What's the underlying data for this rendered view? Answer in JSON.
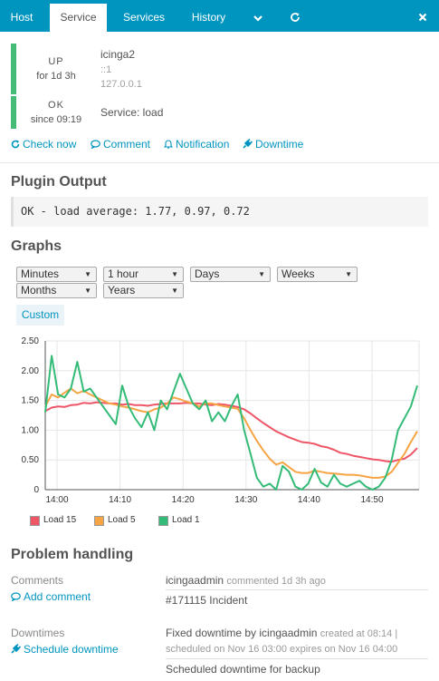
{
  "tabs": {
    "host": "Host",
    "service": "Service",
    "services": "Services",
    "history": "History"
  },
  "host": {
    "state": "UP",
    "duration": "for 1d 3h",
    "name": "icinga2",
    "address6": "::1",
    "address": "127.0.0.1"
  },
  "service": {
    "state": "OK",
    "since": "since 09:19",
    "label": "Service: load"
  },
  "actions": {
    "check_now": "Check now",
    "comment": "Comment",
    "notification": "Notification",
    "downtime": "Downtime"
  },
  "plugin_output": {
    "title": "Plugin Output",
    "text": "OK - load average: 1.77, 0.97, 0.72"
  },
  "graphs": {
    "title": "Graphs",
    "selects": {
      "minutes": "Minutes",
      "hour": "1 hour",
      "days": "Days",
      "weeks": "Weeks",
      "months": "Months",
      "years": "Years"
    },
    "custom": "Custom"
  },
  "colors": {
    "accent": "#0095bf",
    "ok": "#44bb77",
    "load15": "#ee5566",
    "load5": "#f6a444",
    "load1": "#33bb77"
  },
  "chart_data": {
    "type": "line",
    "y_ticks": [
      "0",
      "0.50",
      "1.00",
      "1.50",
      "2.00",
      "2.50"
    ],
    "x_ticks": [
      "14:00",
      "14:10",
      "14:20",
      "14:30",
      "14:40",
      "14:50"
    ],
    "ylim": [
      0,
      2.5
    ],
    "grid": true,
    "legend_position": "bottom-left",
    "series": [
      {
        "name": "Load 15",
        "color": "#ee5566",
        "values": [
          1.32,
          1.38,
          1.4,
          1.39,
          1.42,
          1.43,
          1.46,
          1.45,
          1.47,
          1.46,
          1.45,
          1.45,
          1.43,
          1.44,
          1.42,
          1.42,
          1.41,
          1.43,
          1.44,
          1.45,
          1.45,
          1.45,
          1.46,
          1.45,
          1.45,
          1.43,
          1.42,
          1.44,
          1.43,
          1.41,
          1.39,
          1.35,
          1.28,
          1.2,
          1.12,
          1.05,
          0.98,
          0.93,
          0.88,
          0.84,
          0.8,
          0.79,
          0.77,
          0.73,
          0.71,
          0.67,
          0.62,
          0.6,
          0.57,
          0.55,
          0.53,
          0.51,
          0.5,
          0.48,
          0.47,
          0.5,
          0.52,
          0.59,
          0.7
        ]
      },
      {
        "name": "Load 5",
        "color": "#f6a444",
        "values": [
          1.4,
          1.6,
          1.55,
          1.63,
          1.7,
          1.62,
          1.66,
          1.6,
          1.55,
          1.5,
          1.45,
          1.43,
          1.4,
          1.38,
          1.35,
          1.32,
          1.3,
          1.35,
          1.38,
          1.45,
          1.55,
          1.52,
          1.48,
          1.45,
          1.4,
          1.45,
          1.45,
          1.42,
          1.4,
          1.38,
          1.36,
          1.2,
          1.0,
          0.82,
          0.66,
          0.52,
          0.42,
          0.46,
          0.38,
          0.3,
          0.28,
          0.28,
          0.32,
          0.3,
          0.28,
          0.27,
          0.26,
          0.25,
          0.25,
          0.24,
          0.22,
          0.2,
          0.2,
          0.22,
          0.3,
          0.45,
          0.6,
          0.8,
          0.98
        ]
      },
      {
        "name": "Load 1",
        "color": "#33bb77",
        "values": [
          1.3,
          2.25,
          1.6,
          1.55,
          1.7,
          2.15,
          1.65,
          1.7,
          1.55,
          1.4,
          1.25,
          1.1,
          1.75,
          1.4,
          1.2,
          1.05,
          1.3,
          1.0,
          1.5,
          1.35,
          1.65,
          1.95,
          1.7,
          1.45,
          1.35,
          1.5,
          1.15,
          1.3,
          1.15,
          1.4,
          1.6,
          1.0,
          0.6,
          0.2,
          0.05,
          0.1,
          0.0,
          0.4,
          0.3,
          0.05,
          0.0,
          0.1,
          0.35,
          0.12,
          0.05,
          0.25,
          0.1,
          0.05,
          0.1,
          0.15,
          0.05,
          0.0,
          0.05,
          0.2,
          0.5,
          1.0,
          1.2,
          1.4,
          1.75
        ]
      }
    ]
  },
  "problem_handling": {
    "title": "Problem handling",
    "comments_label": "Comments",
    "add_comment": "Add comment",
    "comment_author": "icingaadmin",
    "comment_meta": "commented 1d 3h ago",
    "comment_text": "#171115 Incident",
    "downtimes_label": "Downtimes",
    "schedule_downtime": "Schedule downtime",
    "downtime_title": "Fixed downtime by icingaadmin",
    "downtime_created": "created at 08:14 |",
    "downtime_schedule": "scheduled on Nov 16 03:00 expires on Nov 16 04:00",
    "downtime_comment": "Scheduled downtime for backup"
  }
}
